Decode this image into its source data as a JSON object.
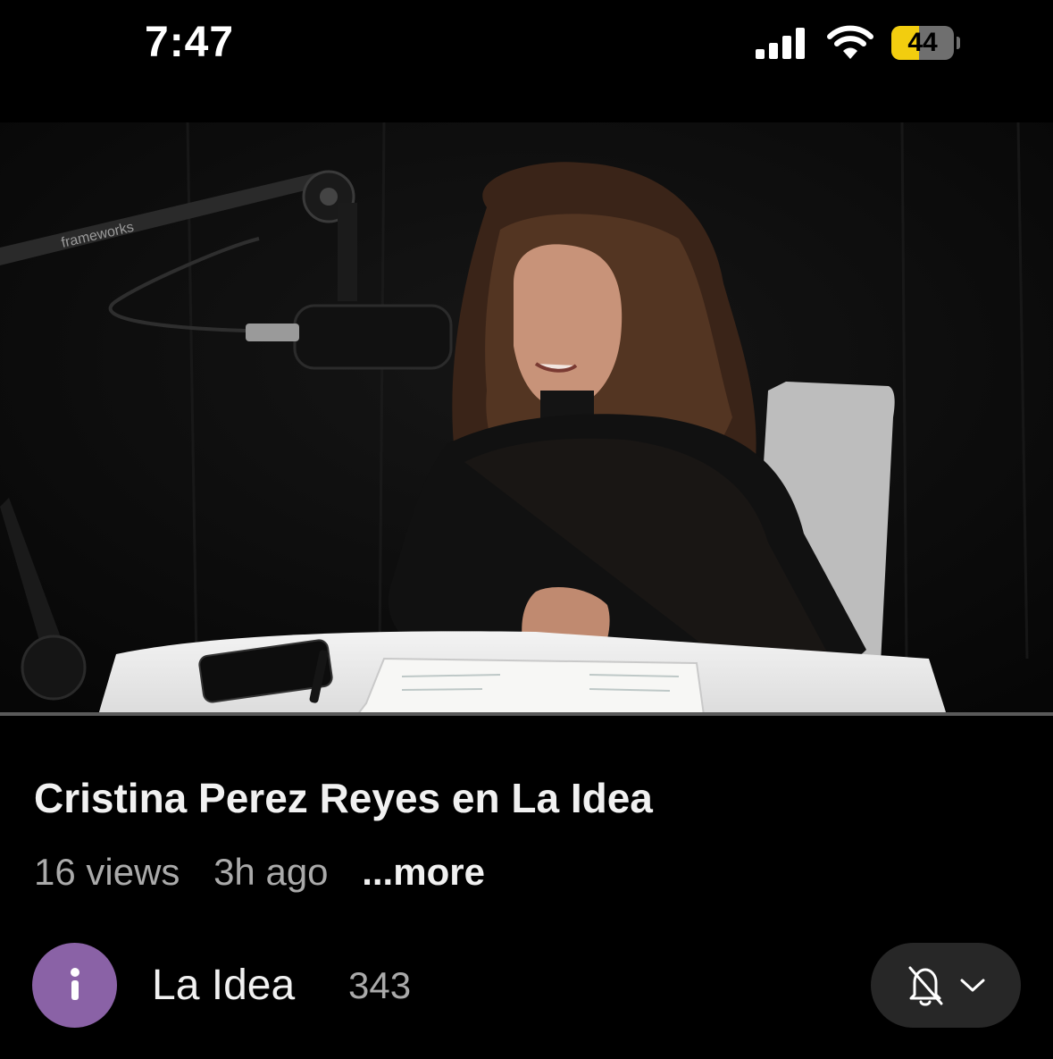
{
  "status_bar": {
    "time": "7:47",
    "battery": "44",
    "battery_level": 0.44,
    "icons": [
      "cellular-signal-icon",
      "wifi-icon",
      "battery-icon"
    ]
  },
  "video": {
    "mic_arm_brand": "frameworks",
    "progress": 0.0
  },
  "title": "Cristina Perez Reyes en La Idea",
  "meta": {
    "views": "16 views",
    "age": "3h ago",
    "more": "...more"
  },
  "channel": {
    "avatar_letter": "i",
    "name": "La Idea",
    "subscribers": "343",
    "avatar_color": "#8a62a6"
  },
  "notification_button": {
    "icons": [
      "bell-off-icon",
      "chevron-down-icon"
    ]
  }
}
